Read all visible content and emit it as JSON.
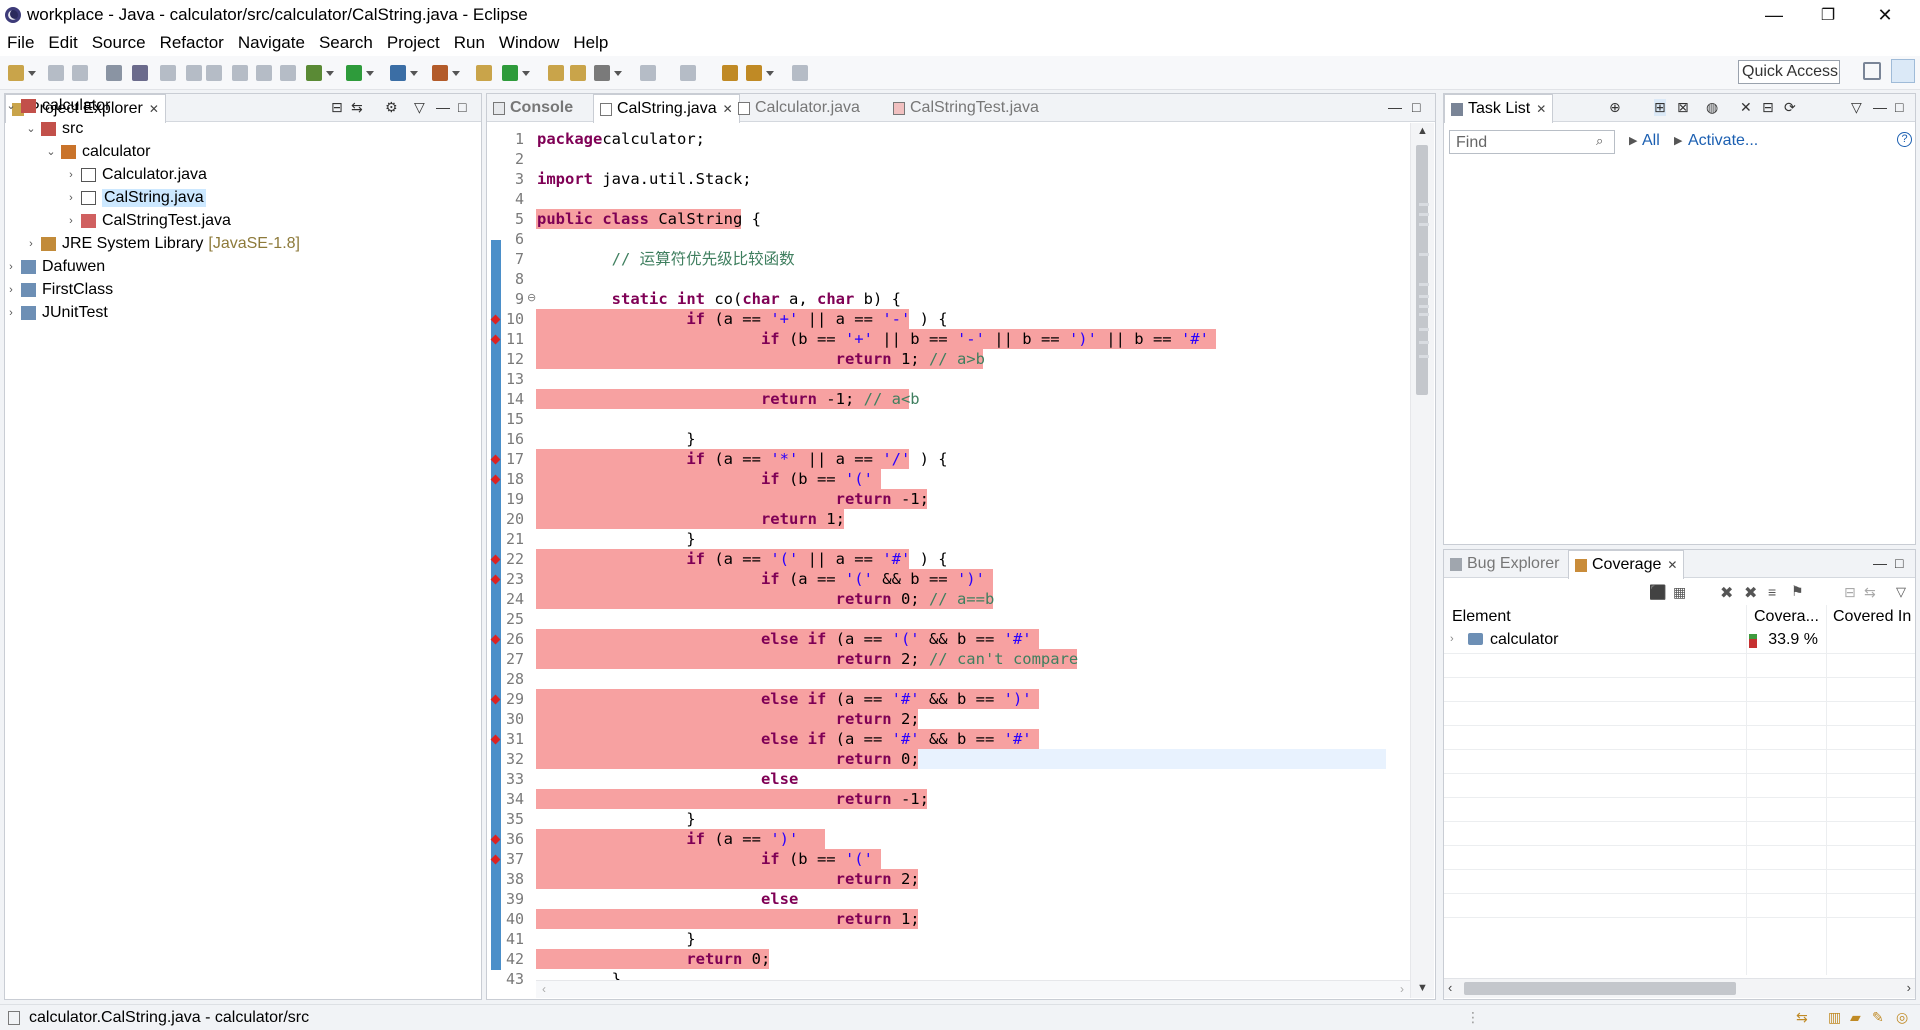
{
  "window": {
    "title": "workplace - Java - calculator/src/calculator/CalString.java - Eclipse",
    "minimize": "—",
    "maximize": "❐",
    "close": "✕"
  },
  "menu": [
    "File",
    "Edit",
    "Source",
    "Refactor",
    "Navigate",
    "Search",
    "Project",
    "Run",
    "Window",
    "Help"
  ],
  "toolbar": {
    "quick_access": "Quick Access"
  },
  "project_explorer": {
    "tab": "Project Explorer",
    "items": [
      {
        "label": "calculator",
        "indent": 0,
        "expanded": true,
        "icon": "java-project-icon"
      },
      {
        "label": "src",
        "indent": 1,
        "expanded": true,
        "icon": "source-folder-icon"
      },
      {
        "label": "calculator",
        "indent": 2,
        "expanded": true,
        "icon": "package-icon"
      },
      {
        "label": "Calculator.java",
        "indent": 3,
        "expanded": false,
        "icon": "java-file-icon"
      },
      {
        "label": "CalString.java",
        "indent": 3,
        "expanded": false,
        "icon": "java-file-icon",
        "selected": true
      },
      {
        "label": "CalStringTest.java",
        "indent": 3,
        "expanded": false,
        "icon": "java-test-file-icon"
      },
      {
        "label": "JRE System Library",
        "suffix": "[JavaSE-1.8]",
        "indent": 1,
        "expanded": false,
        "icon": "library-icon"
      },
      {
        "label": "Dafuwen",
        "indent": 0,
        "expanded": false,
        "icon": "project-icon"
      },
      {
        "label": "FirstClass",
        "indent": 0,
        "expanded": false,
        "icon": "project-icon"
      },
      {
        "label": "JUnitTest",
        "indent": 0,
        "expanded": false,
        "icon": "project-icon"
      }
    ]
  },
  "editor": {
    "tabs": [
      {
        "label": "Console",
        "active": false
      },
      {
        "label": "CalString.java",
        "active": true
      },
      {
        "label": "Calculator.java",
        "active": false
      },
      {
        "label": "CalStringTest.java",
        "active": false
      }
    ],
    "lines": [
      {
        "n": "1",
        "segs": [
          [
            "kw",
            "package"
          ],
          [
            "",
            "calculator;"
          ]
        ]
      },
      {
        "n": "2",
        "segs": []
      },
      {
        "n": "3",
        "segs": [
          [
            "kw",
            "import"
          ],
          [
            "",
            " java.util.Stack;"
          ]
        ]
      },
      {
        "n": "4",
        "segs": []
      },
      {
        "n": "5",
        "hl": [
          0,
          22
        ],
        "segs": [
          [
            "kw",
            "public"
          ],
          [
            "",
            " "
          ],
          [
            "kw",
            "class"
          ],
          [
            "",
            " CalString {"
          ]
        ]
      },
      {
        "n": "6",
        "segs": []
      },
      {
        "n": "7",
        "segs": [
          [
            "",
            "        "
          ],
          [
            "cm",
            "// 运算符优先级比较函数"
          ]
        ]
      },
      {
        "n": "8",
        "segs": []
      },
      {
        "n": "9",
        "fold": true,
        "segs": [
          [
            "",
            "        "
          ],
          [
            "kw",
            "static"
          ],
          [
            "",
            " "
          ],
          [
            "kw",
            "int"
          ],
          [
            "",
            " co("
          ],
          [
            "kw",
            "char"
          ],
          [
            "",
            " a, "
          ],
          [
            "kw",
            "char"
          ],
          [
            "",
            " b) {"
          ]
        ]
      },
      {
        "n": "10",
        "hl": [
          0,
          40
        ],
        "mark": true,
        "segs": [
          [
            "",
            "                "
          ],
          [
            "kw",
            "if"
          ],
          [
            "",
            " (a == "
          ],
          [
            "str",
            "'+'"
          ],
          [
            "",
            " || a == "
          ],
          [
            "str",
            "'-'"
          ],
          [
            "",
            " ) {"
          ]
        ]
      },
      {
        "n": "11",
        "hl": [
          0,
          73
        ],
        "mark": true,
        "segs": [
          [
            "",
            "                        "
          ],
          [
            "kw",
            "if"
          ],
          [
            "",
            " (b == "
          ],
          [
            "str",
            "'+'"
          ],
          [
            "",
            " || b == "
          ],
          [
            "str",
            "'-'"
          ],
          [
            "",
            " || b == "
          ],
          [
            "str",
            "')'"
          ],
          [
            "",
            " || b == "
          ],
          [
            "str",
            "'#'"
          ],
          [
            ")"
          ]
        ]
      },
      {
        "n": "12",
        "hl": [
          0,
          48
        ],
        "segs": [
          [
            "",
            "                                "
          ],
          [
            "kw",
            "return"
          ],
          [
            "",
            " 1; "
          ],
          [
            "cm",
            "// a>b"
          ]
        ]
      },
      {
        "n": "13",
        "segs": []
      },
      {
        "n": "14",
        "hl": [
          0,
          40
        ],
        "segs": [
          [
            "",
            "                        "
          ],
          [
            "kw",
            "return"
          ],
          [
            "",
            " -1; "
          ],
          [
            "cm",
            "// a<b"
          ]
        ]
      },
      {
        "n": "15",
        "segs": []
      },
      {
        "n": "16",
        "segs": [
          [
            "",
            "                }"
          ]
        ]
      },
      {
        "n": "17",
        "hl": [
          0,
          40
        ],
        "mark": true,
        "segs": [
          [
            "",
            "                "
          ],
          [
            "kw",
            "if"
          ],
          [
            "",
            " (a == "
          ],
          [
            "str",
            "'*'"
          ],
          [
            "",
            " || a == "
          ],
          [
            "str",
            "'/'"
          ],
          [
            "",
            " ) {"
          ]
        ]
      },
      {
        "n": "18",
        "hl": [
          0,
          37
        ],
        "mark": true,
        "segs": [
          [
            "",
            "                        "
          ],
          [
            "kw",
            "if"
          ],
          [
            "",
            " (b == "
          ],
          [
            "str",
            "'('"
          ],
          [
            ")"
          ]
        ]
      },
      {
        "n": "19",
        "hl": [
          0,
          42
        ],
        "segs": [
          [
            "",
            "                                "
          ],
          [
            "kw",
            "return"
          ],
          [
            "",
            " -1;"
          ]
        ]
      },
      {
        "n": "20",
        "hl": [
          0,
          33
        ],
        "segs": [
          [
            "",
            "                        "
          ],
          [
            "kw",
            "return"
          ],
          [
            "",
            " 1;"
          ]
        ]
      },
      {
        "n": "21",
        "segs": [
          [
            "",
            "                }"
          ]
        ]
      },
      {
        "n": "22",
        "hl": [
          0,
          40
        ],
        "mark": true,
        "segs": [
          [
            "",
            "                "
          ],
          [
            "kw",
            "if"
          ],
          [
            "",
            " (a == "
          ],
          [
            "str",
            "'('"
          ],
          [
            "",
            " || a == "
          ],
          [
            "str",
            "'#'"
          ],
          [
            "",
            " ) {"
          ]
        ]
      },
      {
        "n": "23",
        "hl": [
          0,
          49
        ],
        "mark": true,
        "segs": [
          [
            "",
            "                        "
          ],
          [
            "kw",
            "if"
          ],
          [
            "",
            " (a == "
          ],
          [
            "str",
            "'('"
          ],
          [
            "",
            " && b == "
          ],
          [
            "str",
            "')'"
          ],
          [
            ")"
          ]
        ]
      },
      {
        "n": "24",
        "hl": [
          0,
          49
        ],
        "segs": [
          [
            "",
            "                                "
          ],
          [
            "kw",
            "return"
          ],
          [
            "",
            " 0; "
          ],
          [
            "cm",
            "// a==b"
          ]
        ]
      },
      {
        "n": "25",
        "segs": []
      },
      {
        "n": "26",
        "hl": [
          0,
          54
        ],
        "mark": true,
        "segs": [
          [
            "",
            "                        "
          ],
          [
            "kw",
            "else"
          ],
          [
            "",
            " "
          ],
          [
            "kw",
            "if"
          ],
          [
            "",
            " (a == "
          ],
          [
            "str",
            "'('"
          ],
          [
            "",
            " && b == "
          ],
          [
            "str",
            "'#'"
          ],
          [
            ")"
          ]
        ]
      },
      {
        "n": "27",
        "hl": [
          0,
          58
        ],
        "segs": [
          [
            "",
            "                                "
          ],
          [
            "kw",
            "return"
          ],
          [
            "",
            " 2; "
          ],
          [
            "cm",
            "// can't compare"
          ]
        ]
      },
      {
        "n": "28",
        "segs": []
      },
      {
        "n": "29",
        "hl": [
          0,
          54
        ],
        "mark": true,
        "segs": [
          [
            "",
            "                        "
          ],
          [
            "kw",
            "else"
          ],
          [
            "",
            " "
          ],
          [
            "kw",
            "if"
          ],
          [
            "",
            " (a == "
          ],
          [
            "str",
            "'#'"
          ],
          [
            "",
            " && b == "
          ],
          [
            "str",
            "')'"
          ],
          [
            ")"
          ]
        ]
      },
      {
        "n": "30",
        "hl": [
          0,
          41
        ],
        "segs": [
          [
            "",
            "                                "
          ],
          [
            "kw",
            "return"
          ],
          [
            "",
            " 2;"
          ]
        ]
      },
      {
        "n": "31",
        "hl": [
          0,
          54
        ],
        "mark": true,
        "segs": [
          [
            "",
            "                        "
          ],
          [
            "kw",
            "else"
          ],
          [
            "",
            " "
          ],
          [
            "kw",
            "if"
          ],
          [
            "",
            " (a == "
          ],
          [
            "str",
            "'#'"
          ],
          [
            "",
            " && b == "
          ],
          [
            "str",
            "'#'"
          ],
          [
            ")"
          ]
        ]
      },
      {
        "n": "32",
        "cur": true,
        "hl": [
          0,
          41
        ],
        "segs": [
          [
            "",
            "                                "
          ],
          [
            "kw",
            "return"
          ],
          [
            "",
            " 0;"
          ]
        ]
      },
      {
        "n": "33",
        "segs": [
          [
            "",
            "                        "
          ],
          [
            "kw",
            "else"
          ]
        ]
      },
      {
        "n": "34",
        "hl": [
          0,
          42
        ],
        "segs": [
          [
            "",
            "                                "
          ],
          [
            "kw",
            "return"
          ],
          [
            "",
            " -1;"
          ]
        ]
      },
      {
        "n": "35",
        "segs": [
          [
            "",
            "                }"
          ]
        ]
      },
      {
        "n": "36",
        "hl": [
          0,
          31
        ],
        "mark": true,
        "segs": [
          [
            "",
            "                "
          ],
          [
            "kw",
            "if"
          ],
          [
            "",
            " (a == "
          ],
          [
            "str",
            "')'"
          ],
          [
            ") {"
          ]
        ]
      },
      {
        "n": "37",
        "hl": [
          0,
          37
        ],
        "mark": true,
        "segs": [
          [
            "",
            "                        "
          ],
          [
            "kw",
            "if"
          ],
          [
            "",
            " (b == "
          ],
          [
            "str",
            "'('"
          ],
          [
            ")"
          ]
        ]
      },
      {
        "n": "38",
        "hl": [
          0,
          41
        ],
        "segs": [
          [
            "",
            "                                "
          ],
          [
            "kw",
            "return"
          ],
          [
            "",
            " 2;"
          ]
        ]
      },
      {
        "n": "39",
        "segs": [
          [
            "",
            "                        "
          ],
          [
            "kw",
            "else"
          ]
        ]
      },
      {
        "n": "40",
        "hl": [
          0,
          41
        ],
        "segs": [
          [
            "",
            "                                "
          ],
          [
            "kw",
            "return"
          ],
          [
            "",
            " 1;"
          ]
        ]
      },
      {
        "n": "41",
        "segs": [
          [
            "",
            "                }"
          ]
        ]
      },
      {
        "n": "42",
        "hl": [
          0,
          25
        ],
        "segs": [
          [
            "",
            "                "
          ],
          [
            "kw",
            "return"
          ],
          [
            "",
            " 0;"
          ]
        ]
      },
      {
        "n": "43",
        "segs": [
          [
            "",
            "        }"
          ]
        ]
      }
    ]
  },
  "task_list": {
    "tab": "Task List",
    "find_placeholder": "Find",
    "all": "All",
    "activate": "Activate..."
  },
  "coverage": {
    "tabs": [
      {
        "label": "Bug Explorer",
        "active": false
      },
      {
        "label": "Coverage",
        "active": true
      }
    ],
    "columns": [
      "Element",
      "Covera...",
      "Covered In"
    ],
    "rows": [
      {
        "element": "calculator",
        "coverage": "33.9 %",
        "coverage_fraction": 0.339
      }
    ]
  },
  "status": {
    "text": "calculator.CalString.java - calculator/src"
  },
  "colors": {
    "coverage_miss": "#f7a1a1",
    "keyword": "#7f0055",
    "string": "#2a00ff",
    "comment": "#3f7f5f",
    "selection": "#cce8ff"
  }
}
